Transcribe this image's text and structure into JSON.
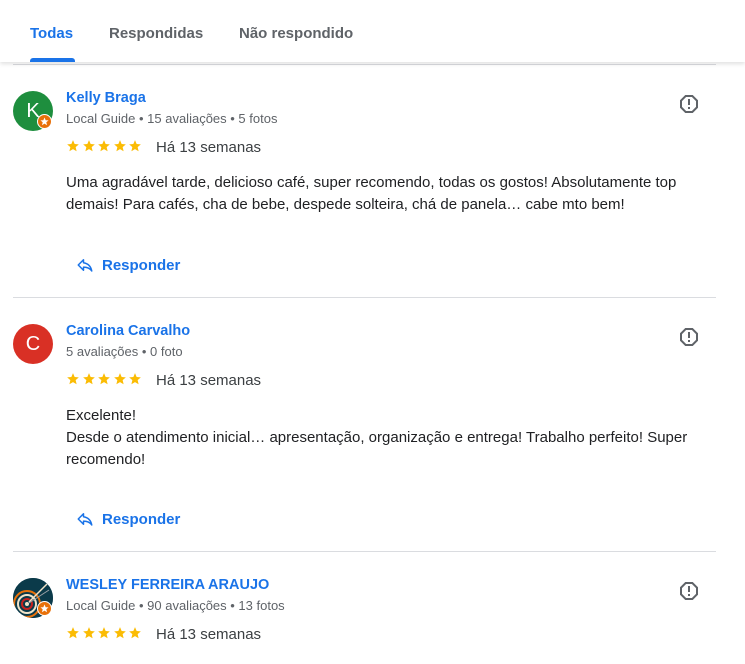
{
  "tabs": [
    {
      "label": "Todas"
    },
    {
      "label": "Respondidas"
    },
    {
      "label": "Não respondido"
    }
  ],
  "colors": {
    "accent": "#1a73e8",
    "guide_badge": "#e8710a",
    "star": "#fbbc04"
  },
  "reviews": [
    {
      "avatar_letter": "K",
      "avatar_color": "#1e8e3e",
      "name": "Kelly Braga",
      "meta": "Local Guide • 15 avaliações • 5 fotos",
      "rating": 5,
      "date": "Há 13 semanas",
      "text": "Uma agradável tarde, delicioso café, super recomendo, todas os gostos! Absolutamente top demais! Para cafés, cha de bebe, despede solteira, chá de panela… cabe mto bem!",
      "reply_label": "Responder"
    },
    {
      "avatar_letter": "C",
      "avatar_color": "#d93025",
      "name": "Carolina Carvalho",
      "meta": "5 avaliações • 0 foto",
      "rating": 5,
      "date": "Há 13 semanas",
      "text_line1": "Excelente!",
      "text_line2": "Desde o atendimento inicial… apresentação, organização e entrega! Trabalho perfeito! Super recomendo!",
      "reply_label": "Responder"
    },
    {
      "avatar_letter": "",
      "name": "WESLEY FERREIRA ARAUJO",
      "meta": "Local Guide • 90 avaliações • 13 fotos",
      "rating": 5,
      "date": "Há 13 semanas"
    }
  ]
}
